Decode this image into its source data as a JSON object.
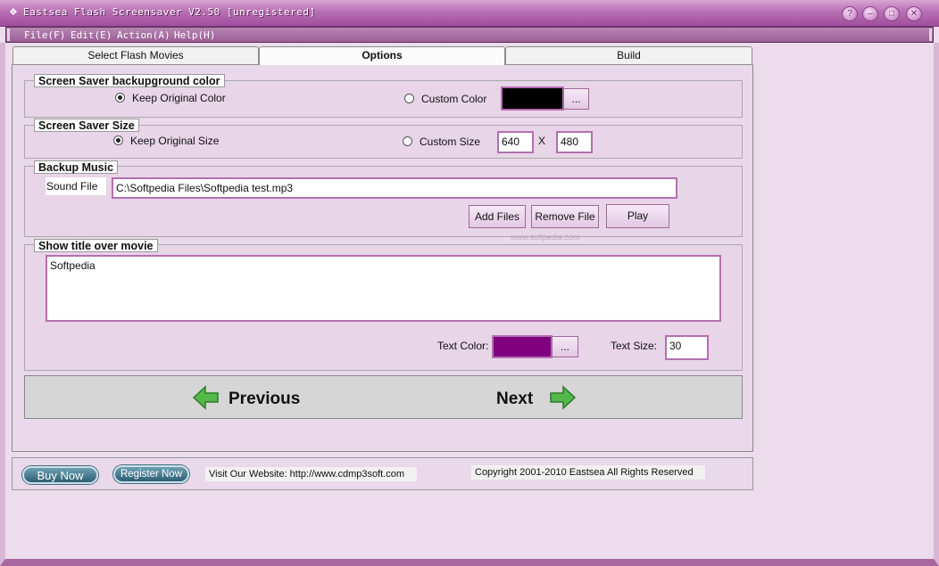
{
  "window": {
    "title": "Eastsea Flash Screensaver V2.50 [unregistered]"
  },
  "menu": [
    "File(F)",
    "Edit(E)",
    "Action(A)",
    "Help(H)"
  ],
  "tabs": [
    "Select Flash Movies",
    "Options",
    "Build"
  ],
  "bg_group": {
    "legend": "Screen Saver backupground color",
    "keep_label": "Keep Original Color",
    "custom_label": "Custom Color",
    "swatch_color": "#000000",
    "browse": "..."
  },
  "size_group": {
    "legend": "Screen Saver Size",
    "keep_label": "Keep Original Size",
    "custom_label": "Custom Size",
    "width": "640",
    "times": "X",
    "height": "480"
  },
  "music_group": {
    "legend": "Backup Music",
    "sound_label": "Sound File",
    "sound_path": "C:\\Softpedia Files\\Softpedia test.mp3",
    "add": "Add Files",
    "remove": "Remove File",
    "play": "Play"
  },
  "title_group": {
    "legend": "Show title over movie",
    "text": "Softpedia",
    "text_color_label": "Text Color:",
    "text_color": "#800080",
    "browse": "...",
    "text_size_label": "Text Size:",
    "text_size": "30"
  },
  "nav": {
    "previous": "Previous",
    "next": "Next"
  },
  "footer": {
    "buy": "Buy Now",
    "register": "Register Now",
    "website": "Visit Our Website: http://www.cdmp3soft.com",
    "copyright": "Copyright 2001-2010 Eastsea All Rights Reserved"
  },
  "watermark": "www.softpedia.com"
}
